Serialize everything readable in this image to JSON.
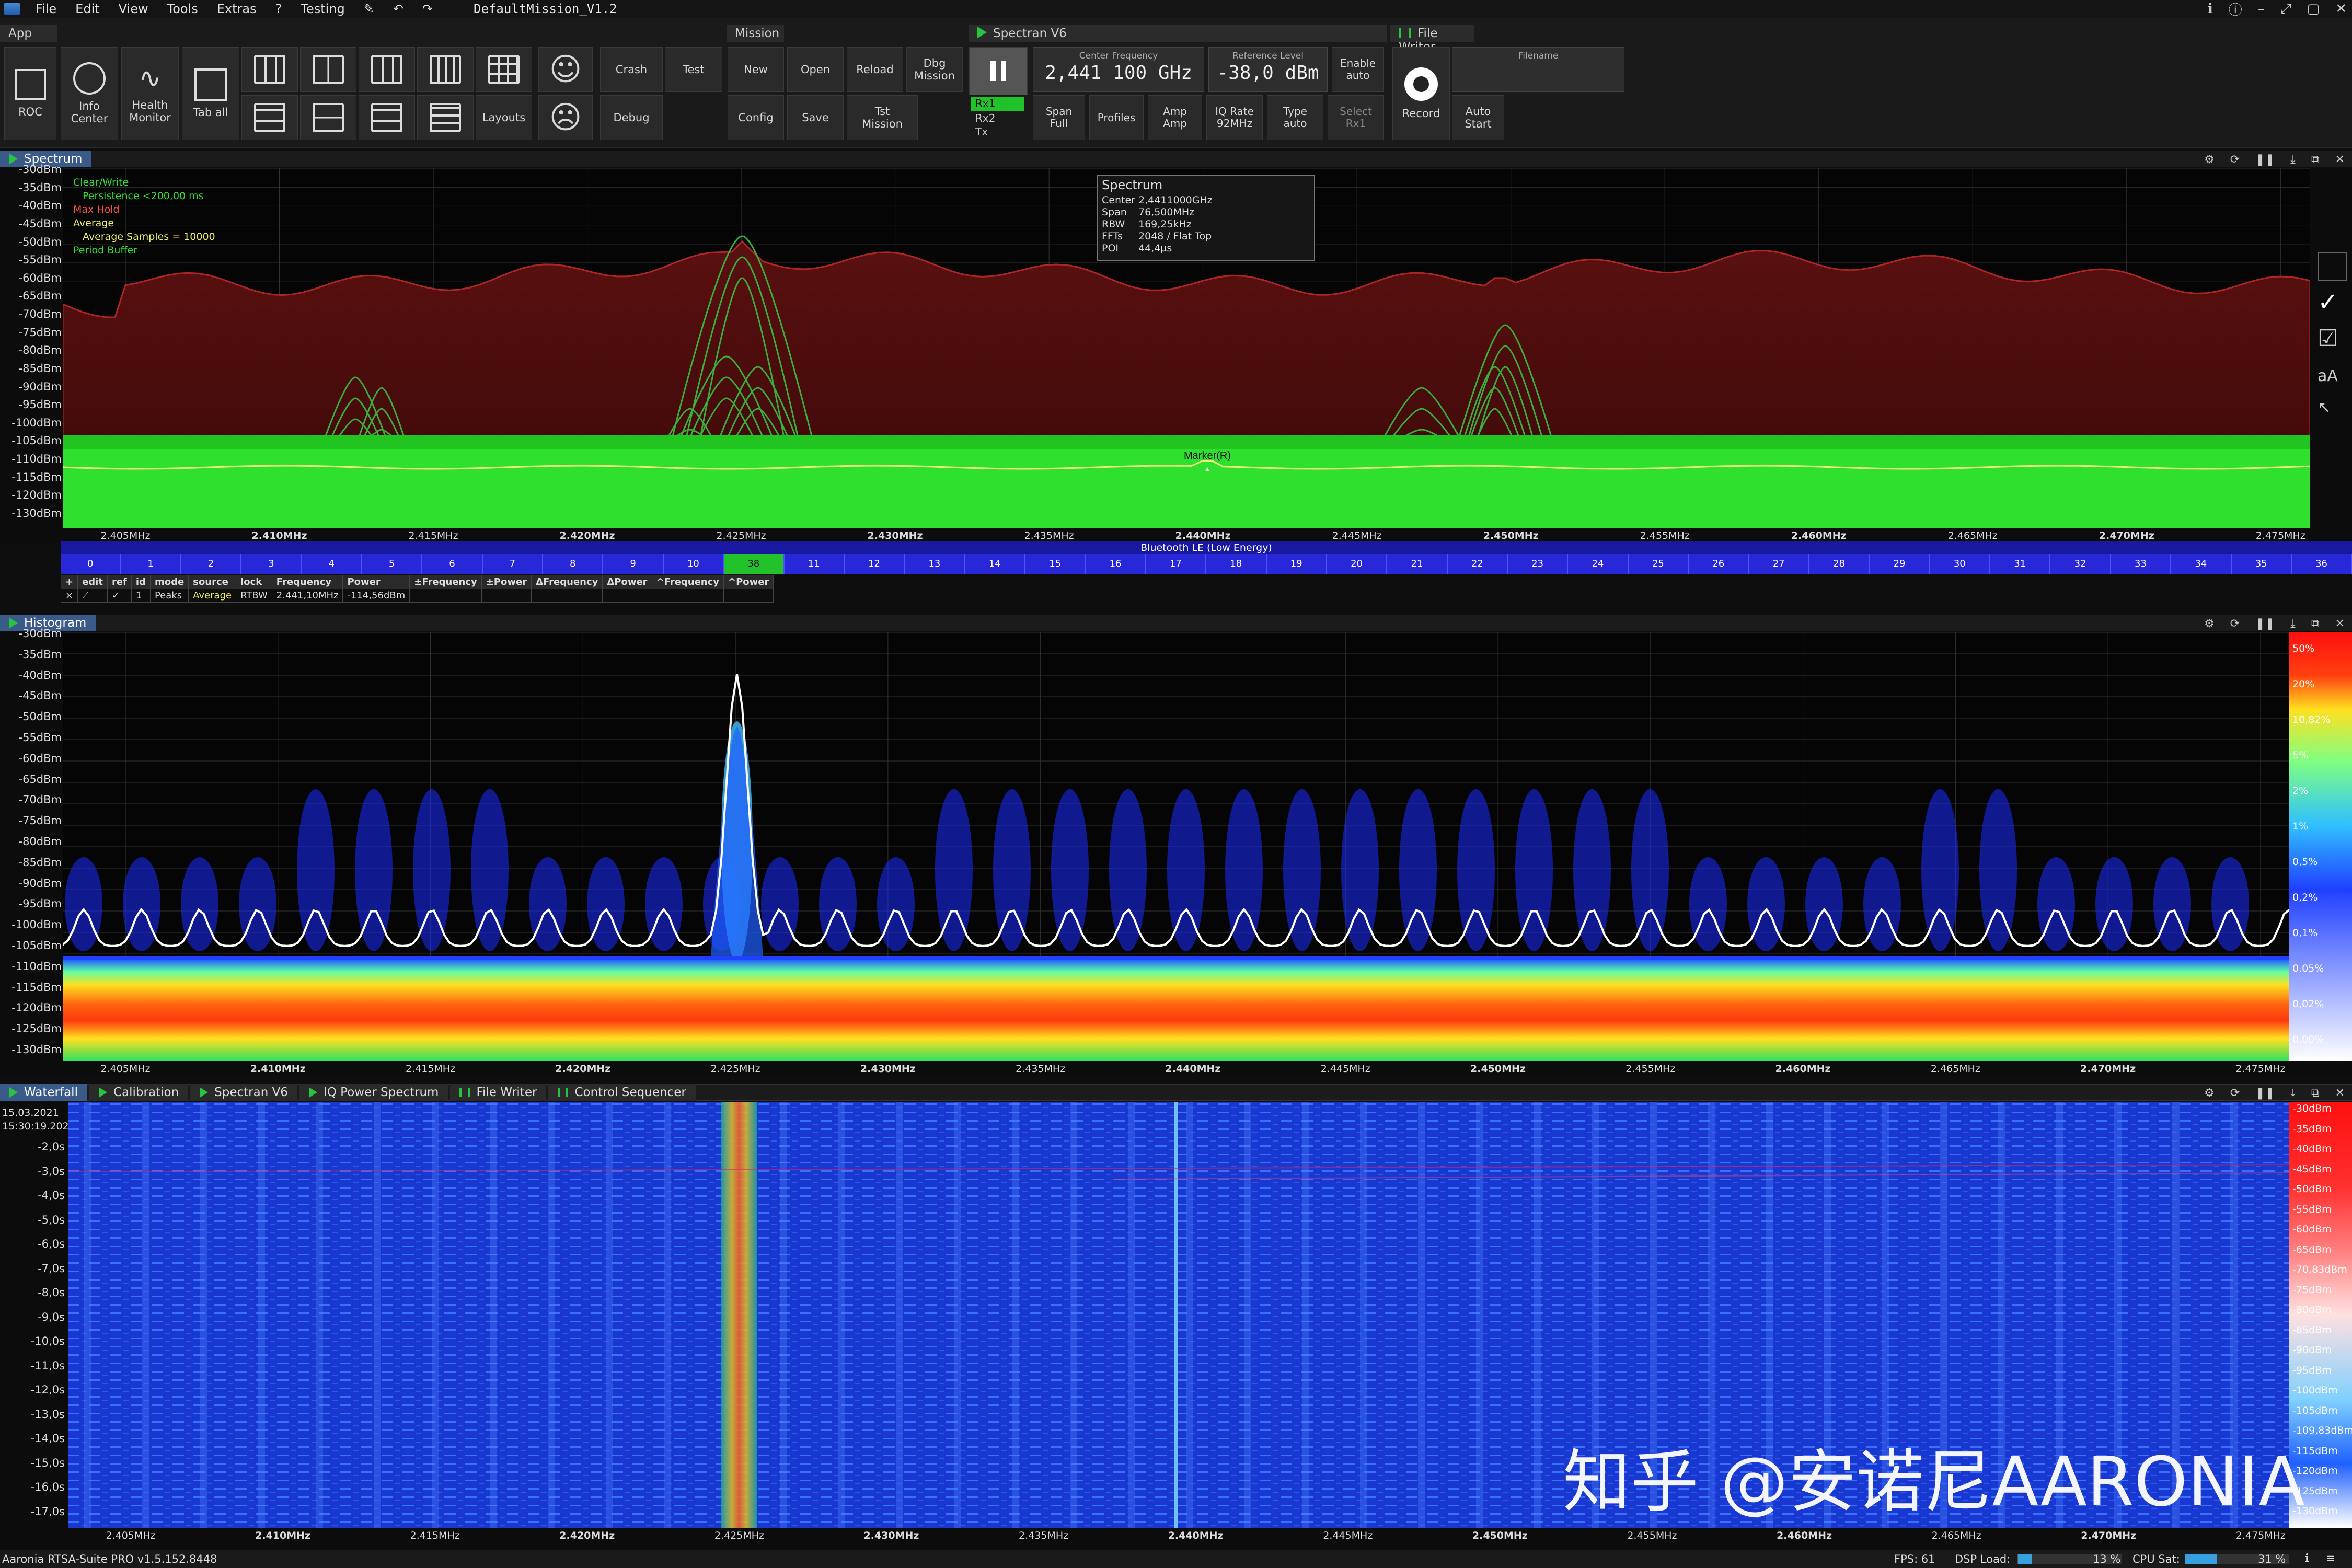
{
  "menu": {
    "items": [
      "File",
      "Edit",
      "View",
      "Tools",
      "Extras",
      "?",
      "Testing"
    ],
    "window_title": "DefaultMission_V1.2"
  },
  "toolbar": {
    "groups": {
      "app": "App",
      "mission": "Mission",
      "spectran": "Spectran V6",
      "filewriter": "File Writer"
    },
    "app": {
      "roc": "ROC",
      "info": "Info\nCenter",
      "health": "Health\nMonitor",
      "tab_all": "Tab all",
      "layouts": "Layouts",
      "crash": "Crash",
      "test": "Test",
      "debug": "Debug"
    },
    "mission": {
      "new": "New",
      "open": "Open",
      "reload": "Reload",
      "dbg": "Dbg\nMission",
      "config": "Config",
      "save": "Save",
      "tst": "Tst\nMission"
    },
    "spectran": {
      "rx1": "Rx1",
      "rx2": "Rx2",
      "tx": "Tx",
      "center_label": "Center Frequency",
      "center_value": "2,441 100 GHz",
      "ref_label": "Reference Level",
      "ref_value": "-38,0 dBm",
      "enable_label": "Enable",
      "enable_value": "auto",
      "span_label": "Span",
      "span_value": "Full",
      "profiles": "Profiles",
      "amp_label": "Amp",
      "amp_value": "Amp",
      "iq_label": "IQ Rate",
      "iq_value": "92MHz",
      "type_label": "Type",
      "type_value": "auto",
      "select_label": "Select",
      "select_value": "Rx1"
    },
    "filewriter": {
      "record": "Record",
      "auto_start": "Auto\nStart",
      "filename_label": "Filename"
    }
  },
  "spectrum": {
    "tab": "Spectrum",
    "legend": {
      "clear_write": "Clear/Write",
      "persistence": "Persistence  <200,00 ms",
      "max_hold": "Max Hold",
      "average": "Average",
      "avg_samples": "Average Samples = 10000",
      "period_buffer": "Period Buffer"
    },
    "info": {
      "title": "Spectrum",
      "rows": [
        [
          "Center",
          "2,4411000GHz"
        ],
        [
          "Span",
          "76,500MHz"
        ],
        [
          "RBW",
          "169,25kHz"
        ],
        [
          "FFTs",
          "2048 / Flat Top"
        ],
        [
          "POI",
          "44,4µs"
        ]
      ]
    },
    "marker": "Marker(R)",
    "y_labels": [
      "-30dBm",
      "-35dBm",
      "-40dBm",
      "-45dBm",
      "-50dBm",
      "-55dBm",
      "-60dBm",
      "-65dBm",
      "-70dBm",
      "-75dBm",
      "-80dBm",
      "-85dBm",
      "-90dBm",
      "-95dBm",
      "-100dBm",
      "-105dBm",
      "-110dBm",
      "-115dBm",
      "-120dBm",
      "-130dBm"
    ],
    "ble_label": "Bluetooth LE (Low Energy)",
    "channels": [
      "0",
      "1",
      "2",
      "3",
      "4",
      "5",
      "6",
      "7",
      "8",
      "9",
      "10",
      "38",
      "11",
      "12",
      "13",
      "14",
      "15",
      "16",
      "17",
      "18",
      "19",
      "20",
      "21",
      "22",
      "23",
      "24",
      "25",
      "26",
      "27",
      "28",
      "29",
      "30",
      "31",
      "32",
      "33",
      "34",
      "35",
      "36"
    ],
    "active_channel": "38",
    "marker_table": {
      "headers": [
        "+",
        "edit",
        "ref",
        "id",
        "mode",
        "source",
        "lock",
        "Frequency",
        "Power",
        "±Frequency",
        "±Power",
        "ΔFrequency",
        "ΔPower",
        "^Frequency",
        "^Power"
      ],
      "row": [
        "×",
        "⟋",
        "✓",
        "1",
        "Peaks",
        "Average",
        "RTBW",
        "2.441,10MHz",
        "-114,56dBm",
        "",
        "",
        "",
        "",
        "",
        ""
      ]
    }
  },
  "x_labels": [
    "2.405MHz",
    "2.410MHz",
    "2.415MHz",
    "2.420MHz",
    "2.425MHz",
    "2.430MHz",
    "2.435MHz",
    "2.440MHz",
    "2.445MHz",
    "2.450MHz",
    "2.455MHz",
    "2.460MHz",
    "2.465MHz",
    "2.470MHz",
    "2.475MHz"
  ],
  "histogram": {
    "tab": "Histogram",
    "y_labels": [
      "-30dBm",
      "-35dBm",
      "-40dBm",
      "-45dBm",
      "-50dBm",
      "-55dBm",
      "-60dBm",
      "-65dBm",
      "-70dBm",
      "-75dBm",
      "-80dBm",
      "-85dBm",
      "-90dBm",
      "-95dBm",
      "-100dBm",
      "-105dBm",
      "-110dBm",
      "-115dBm",
      "-120dBm",
      "-125dBm",
      "-130dBm"
    ],
    "scale": [
      "50%",
      "20%",
      "10,82%",
      "5%",
      "2%",
      "1%",
      "0,5%",
      "0,2%",
      "0,1%",
      "0,05%",
      "0,02%",
      "0,00%"
    ]
  },
  "waterfall": {
    "tabs": [
      "Waterfall",
      "Calibration",
      "Spectran V6",
      "IQ Power Spectrum",
      "File Writer",
      "Control Sequencer"
    ],
    "date": "15.03.2021",
    "time": "15:30:19.202",
    "y_labels": [
      "-2,0s",
      "-3,0s",
      "-4,0s",
      "-5,0s",
      "-6,0s",
      "-7,0s",
      "-8,0s",
      "-9,0s",
      "-10,0s",
      "-11,0s",
      "-12,0s",
      "-13,0s",
      "-14,0s",
      "-15,0s",
      "-16,0s",
      "-17,0s"
    ],
    "scale": [
      "-30dBm",
      "-35dBm",
      "-40dBm",
      "-45dBm",
      "-50dBm",
      "-55dBm",
      "-60dBm",
      "-65dBm",
      "-70,83dBm",
      "-75dBm",
      "-80dBm",
      "-85dBm",
      "-90dBm",
      "-95dBm",
      "-100dBm",
      "-105dBm",
      "-109,83dBm",
      "-115dBm",
      "-120dBm",
      "-125dBm",
      "-130dBm"
    ]
  },
  "watermark": "知乎 @安诺尼AARONIA",
  "status": {
    "app": "Aaronia RTSA-Suite PRO v1.5.152.8448",
    "fps": "FPS: 61",
    "dsp_label": "DSP Load:",
    "dsp_value": "13 %",
    "dsp_fraction": 0.13,
    "cpu_label": "CPU Sat:",
    "cpu_value": "31 %",
    "cpu_fraction": 0.31
  },
  "colors": {
    "accent": "#27c43d",
    "ble_channel": "#2828d8",
    "active_channel": "#22c22a",
    "max_hold": "#8b1a1a"
  }
}
